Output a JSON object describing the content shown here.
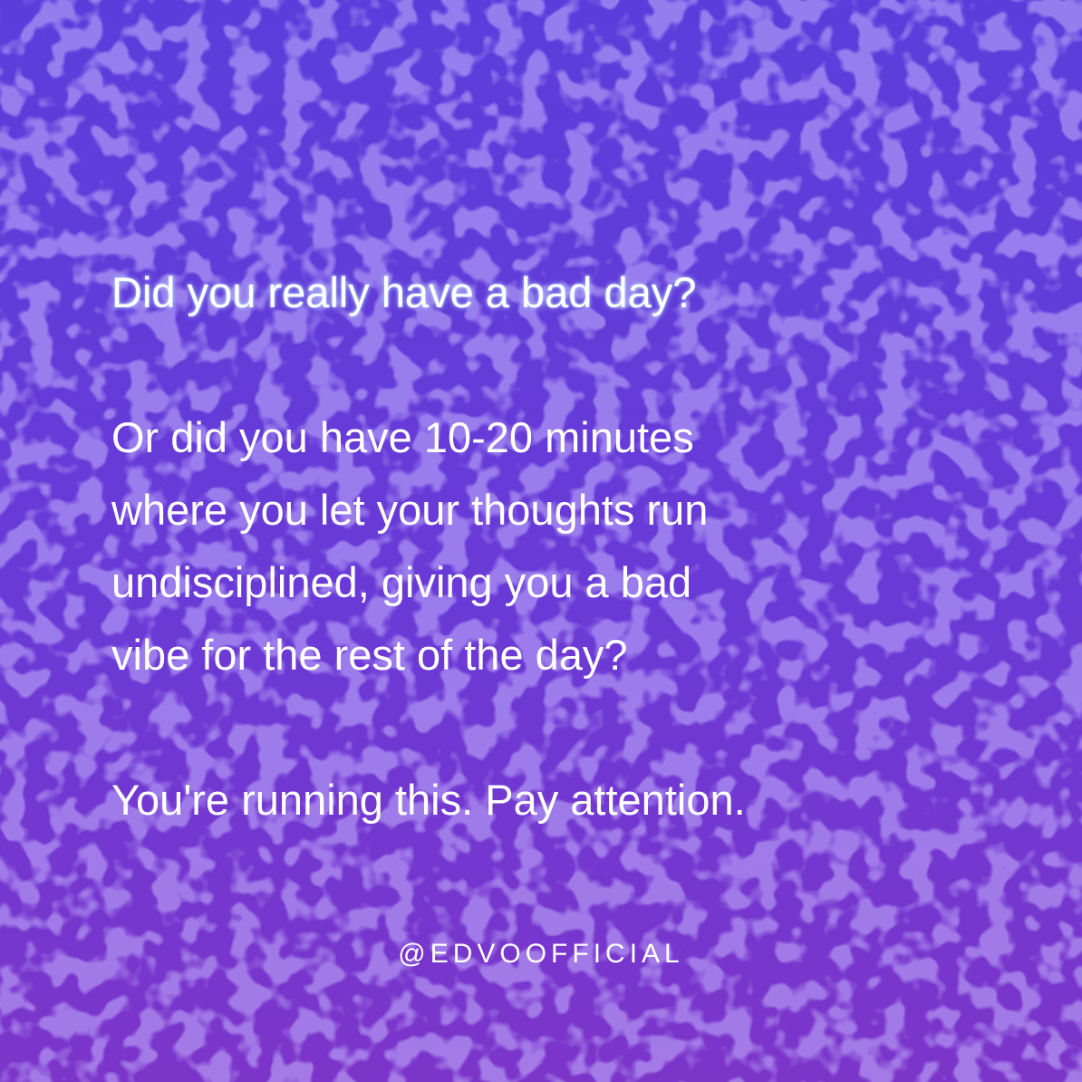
{
  "colors": {
    "background_top": "#5a3edb",
    "background_bottom": "#7c35c9",
    "text": "#ffffff"
  },
  "question": "Did you really have a bad day?",
  "body_lines": [
    "Or did you have 10-20 minutes",
    "where you let your thoughts run",
    "undisciplined, giving you a bad",
    "vibe for the rest of the day?"
  ],
  "closing": "You're running this. Pay attention.",
  "handle": "@EDVOOFFICIAL"
}
